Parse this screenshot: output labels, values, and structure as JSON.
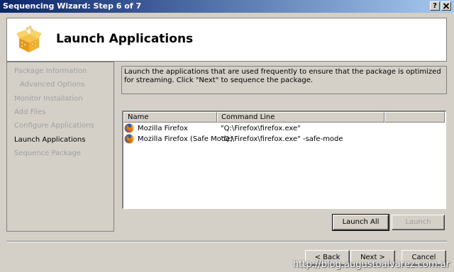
{
  "window": {
    "title": "Sequencing Wizard: Step 6 of 7",
    "help_label": "?",
    "close_label": "X"
  },
  "header": {
    "title": "Launch Applications",
    "icon": "package-box-icon"
  },
  "nav": {
    "items": [
      {
        "label": "Package Information",
        "state": "inactive"
      },
      {
        "label": "Advanced Options",
        "state": "inactive",
        "sub": true
      },
      {
        "label": "Monitor Installation",
        "state": "inactive"
      },
      {
        "label": "Add Files",
        "state": "inactive"
      },
      {
        "label": "Configure Applications",
        "state": "inactive"
      },
      {
        "label": "Launch Applications",
        "state": "active"
      },
      {
        "label": "Sequence Package",
        "state": "inactive"
      }
    ]
  },
  "content": {
    "description": "Launch the applications that are used frequently to ensure that the package is optimized for streaming. Click \"Next\" to sequence the package.",
    "table": {
      "columns": [
        "Name",
        "Command Line"
      ],
      "rows": [
        {
          "name": "Mozilla Firefox",
          "command": "\"Q:\\Firefox\\firefox.exe\"",
          "icon": "firefox-icon"
        },
        {
          "name": "Mozilla Firefox (Safe Mode)",
          "command": "\"Q:\\Firefox\\firefox.exe\" -safe-mode",
          "icon": "firefox-icon"
        }
      ]
    },
    "launch_all_label": "Launch All",
    "launch_label": "Launch"
  },
  "footer": {
    "back_label": "< Back",
    "next_label": "Next >",
    "cancel_label": "Cancel"
  },
  "watermark": "http://blog.augustoalvarez.com.ar",
  "colors": {
    "title_gradient_start": "#0a246a",
    "title_gradient_end": "#a6caf0",
    "dialog_bg": "#d4d0c8",
    "disabled_text": "#a0a0a0"
  }
}
